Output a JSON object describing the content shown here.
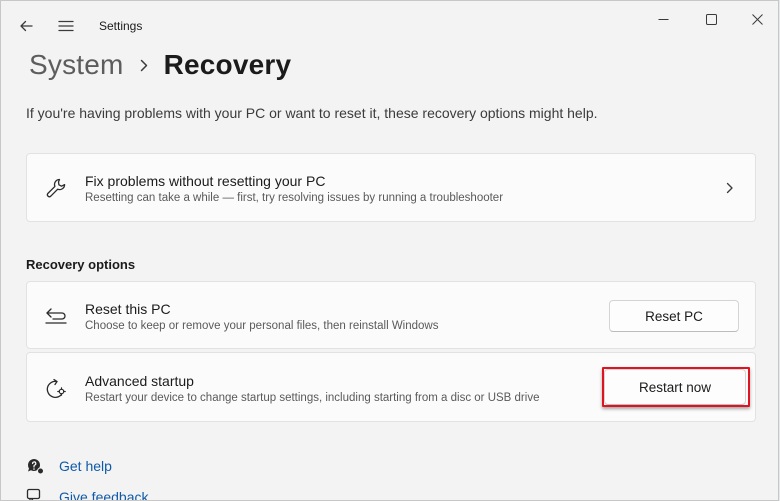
{
  "window": {
    "title": "Settings",
    "back_icon": "back-arrow-icon",
    "menu_icon": "hamburger-menu-icon",
    "controls": [
      "minimize-icon",
      "maximize-icon",
      "close-icon"
    ]
  },
  "breadcrumb": {
    "parent": "System",
    "separator_icon": "chevron-right-icon",
    "current": "Recovery"
  },
  "intro": "If you're having problems with your PC or want to reset it, these recovery options might help.",
  "fix_card": {
    "icon": "wrench-icon",
    "title": "Fix problems without resetting your PC",
    "description": "Resetting can take a while — first, try resolving issues by running a troubleshooter",
    "chevron_icon": "chevron-right-icon"
  },
  "recovery_options": {
    "heading": "Recovery options",
    "items": [
      {
        "icon": "reset-pc-icon",
        "title": "Reset this PC",
        "description": "Choose to keep or remove your personal files, then reinstall Windows",
        "button_label": "Reset PC"
      },
      {
        "icon": "advanced-startup-icon",
        "title": "Advanced startup",
        "description": "Restart your device to change startup settings, including starting from a disc or USB drive",
        "button_label": "Restart now"
      }
    ]
  },
  "links": [
    {
      "icon": "get-help-icon",
      "label": "Get help"
    },
    {
      "icon": "give-feedback-icon",
      "label": "Give feedback"
    }
  ],
  "colors": {
    "accent_link": "#0f5aa8",
    "highlight": "#e0141e",
    "window_bg": "#f3f3f3",
    "card_bg": "#fbfbfb"
  }
}
